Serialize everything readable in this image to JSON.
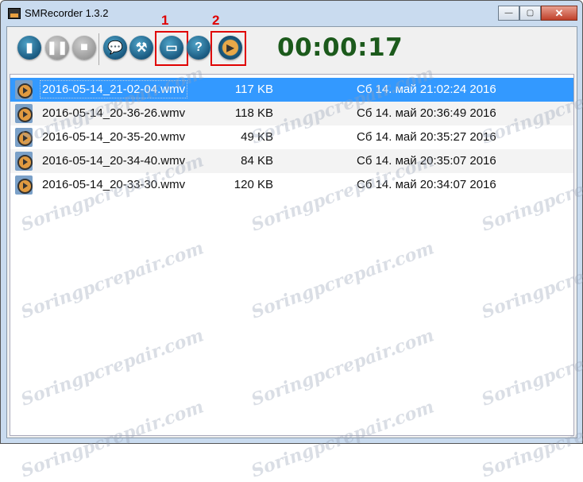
{
  "window": {
    "title": "SMRecorder 1.3.2",
    "min": "—",
    "max": "▢",
    "close": "✕"
  },
  "toolbar": {
    "buttons": [
      {
        "name": "new-recording",
        "icon": "document-icon",
        "glyph": "▮",
        "disabled": false
      },
      {
        "name": "pause",
        "icon": "pause-icon",
        "glyph": "❚❚",
        "disabled": true
      },
      {
        "name": "stop",
        "icon": "stop-icon",
        "glyph": "■",
        "disabled": true
      },
      {
        "name": "comment",
        "icon": "speech-bubble-icon",
        "glyph": "💬",
        "disabled": false
      },
      {
        "name": "settings",
        "icon": "tools-icon",
        "glyph": "⚒",
        "disabled": false
      },
      {
        "name": "open-folder",
        "icon": "folder-icon",
        "glyph": "▭",
        "disabled": false
      },
      {
        "name": "help",
        "icon": "help-icon",
        "glyph": "?",
        "disabled": false
      },
      {
        "name": "play",
        "icon": "play-icon",
        "glyph": "▶",
        "disabled": false
      }
    ],
    "annotation_1": "1",
    "annotation_2": "2",
    "timer": "00:00:17"
  },
  "files": [
    {
      "name": "2016-05-14_21-02-04.wmv",
      "size": "117 KB",
      "date": "Сб 14. май 21:02:24 2016",
      "selected": true
    },
    {
      "name": "2016-05-14_20-36-26.wmv",
      "size": "118 KB",
      "date": "Сб 14. май 20:36:49 2016"
    },
    {
      "name": "2016-05-14_20-35-20.wmv",
      "size": "49 KB",
      "date": "Сб 14. май 20:35:27 2016"
    },
    {
      "name": "2016-05-14_20-34-40.wmv",
      "size": "84 KB",
      "date": "Сб 14. май 20:35:07 2016"
    },
    {
      "name": "2016-05-14_20-33-30.wmv",
      "size": "120 KB",
      "date": "Сб 14. май 20:34:07 2016"
    }
  ],
  "watermark": "Soringpcrepair.com"
}
